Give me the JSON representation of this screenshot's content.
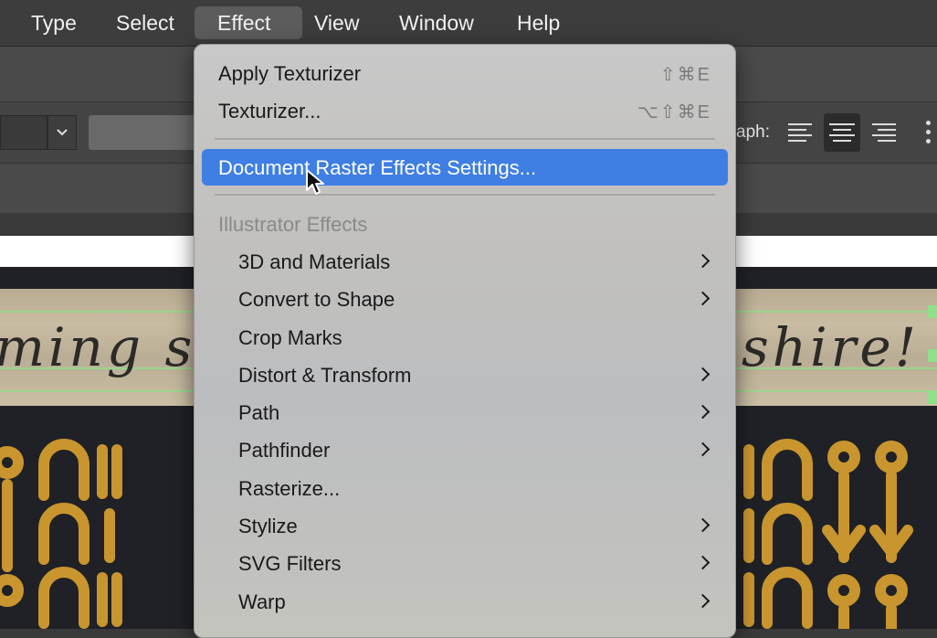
{
  "menubar": {
    "items": [
      "Type",
      "Select",
      "Effect",
      "View",
      "Window",
      "Help"
    ],
    "active": "Effect"
  },
  "toolbar": {
    "paragraph_label": "aph:"
  },
  "canvas": {
    "text_left": "ming s",
    "text_right": "shire!"
  },
  "effect_menu": {
    "apply_texturizer": {
      "label": "Apply Texturizer",
      "shortcut": "⇧⌘E"
    },
    "texturizer": {
      "label": "Texturizer...",
      "shortcut": "⌥⇧⌘E"
    },
    "document_raster": {
      "label": "Document Raster Effects Settings..."
    },
    "illustrator_effects_header": "Illustrator Effects",
    "items": [
      {
        "label": "3D and Materials",
        "submenu": true
      },
      {
        "label": "Convert to Shape",
        "submenu": true
      },
      {
        "label": "Crop Marks",
        "submenu": false
      },
      {
        "label": "Distort & Transform",
        "submenu": true
      },
      {
        "label": "Path",
        "submenu": true
      },
      {
        "label": "Pathfinder",
        "submenu": true
      },
      {
        "label": "Rasterize...",
        "submenu": false
      },
      {
        "label": "Stylize",
        "submenu": true
      },
      {
        "label": "SVG Filters",
        "submenu": true
      },
      {
        "label": "Warp",
        "submenu": true
      }
    ]
  },
  "colors": {
    "highlight": "#3f7fe3",
    "menubar_bg": "#3d3d3d",
    "gold": "#c9952e"
  }
}
